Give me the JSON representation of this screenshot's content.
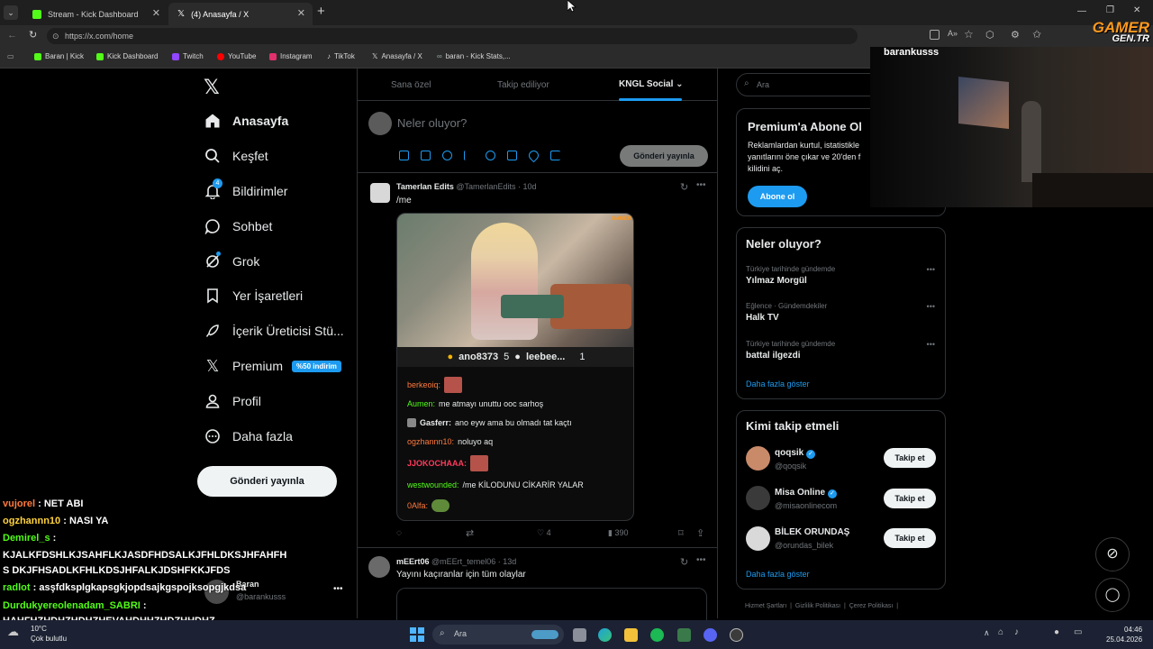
{
  "browser": {
    "tabs": [
      {
        "label": "Stream - Kick Dashboard"
      },
      {
        "label": "(4) Anasayfa / X"
      }
    ],
    "url": "https://x.com/home",
    "bookmarks": [
      "Baran | Kick",
      "Kick Dashboard",
      "Twitch",
      "YouTube",
      "Instagram",
      "TikTok",
      "Anasayfa / X",
      "baran - Kick Stats,..."
    ]
  },
  "nav": {
    "items": [
      {
        "label": "Anasayfa",
        "icon": "home-icon"
      },
      {
        "label": "Keşfet",
        "icon": "search-icon"
      },
      {
        "label": "Bildirimler",
        "icon": "bell-icon",
        "badge": "4"
      },
      {
        "label": "Sohbet",
        "icon": "chat-icon"
      },
      {
        "label": "Grok",
        "icon": "grok-icon"
      },
      {
        "label": "Yer İşaretleri",
        "icon": "bookmark-icon"
      },
      {
        "label": "İçerik Üreticisi Stü...",
        "icon": "rocket-icon"
      },
      {
        "label": "Premium",
        "icon": "x-premium-icon",
        "pill": "%50 indirim"
      },
      {
        "label": "Profil",
        "icon": "profile-icon"
      },
      {
        "label": "Daha fazla",
        "icon": "more-icon"
      }
    ],
    "post_button": "Gönderi yayınla",
    "account": {
      "name": "Baran",
      "handle": "@barankusss"
    }
  },
  "feed": {
    "tabs": [
      "Sana özel",
      "Takip ediliyor",
      "KNGL Social"
    ],
    "composer_placeholder": "Neler oluyor?",
    "composer_button": "Gönderi yayınla",
    "post1": {
      "name": "Tamerlan Edits",
      "handle": "@TamerlanEdits · 10d",
      "text": "/me",
      "media_bar": {
        "left": "ano8373",
        "mid": "5",
        "right": "leebee...",
        "count": "1"
      },
      "chat": [
        {
          "user": "berkeoiq:",
          "color": "#ff7a3d",
          "msg": ""
        },
        {
          "user": "Aumen:",
          "color": "#53fc18",
          "msg": "me atmayı unuttu ooc sarhoş"
        },
        {
          "user": "Gasferr:",
          "color": "#e7e9ea",
          "msg": "ano eyw ama bu olmadı tat kaçtı"
        },
        {
          "user": "ogzhannn10:",
          "color": "#ff7a3d",
          "msg": "noluyo aq"
        },
        {
          "user": "JJOKOCHAAA:",
          "color": "#ff3b5c",
          "msg": ""
        },
        {
          "user": "westwounded:",
          "color": "#53fc18",
          "msg": "/me KİLODUNU CİKARİR YALAR"
        },
        {
          "user": "0Alfa:",
          "color": "#ff7a3d",
          "msg": ""
        }
      ],
      "stats": {
        "likes": "4",
        "views": "390"
      }
    },
    "post2": {
      "name": "mEErt06",
      "handle": "@mEErt_temel06 · 13d",
      "text": "Yayını kaçıranlar için tüm olaylar"
    }
  },
  "sidebar": {
    "search_placeholder": "Ara",
    "premium": {
      "title": "Premium'a Abone Ol",
      "text": "Reklamlardan kurtul, istatistikle yanıtlarını öne çıkar ve 20'den f kilidini aç.",
      "button": "Abone ol"
    },
    "trends_title": "Neler oluyor?",
    "trends": [
      {
        "meta": "Türkiye tarihinde gündemde",
        "name": "Yılmaz Morgül"
      },
      {
        "meta": "Eğlence · Gündemdekiler",
        "name": "Halk TV"
      },
      {
        "meta": "Türkiye tarihinde gündemde",
        "name": "battal ilgezdi"
      }
    ],
    "show_more": "Daha fazla göster",
    "follow_title": "Kimi takip etmeli",
    "follow": [
      {
        "name": "qoqsik",
        "handle": "@qoqsik",
        "verified": true,
        "color": "#c98a6a"
      },
      {
        "name": "Misa Online",
        "handle": "@misaonlinecom",
        "verified": true,
        "color": "#3a3a3a"
      },
      {
        "name": "BİLEK ORUNDAŞ",
        "handle": "@orundas_bilek",
        "verified": false,
        "color": "#d9d9d9"
      }
    ],
    "follow_button": "Takip et",
    "footer": [
      "Hizmet Şartları",
      "Gizlilik Politikası",
      "Çerez Politikası"
    ]
  },
  "stream": {
    "webcam_name": "barankusss",
    "logo_top": "GAMER",
    "logo_bottom": "GEN.TR",
    "chat": [
      {
        "user": "vujorel",
        "color": "#ff7a3d",
        "msg": "NET ABI"
      },
      {
        "user": "ogzhannn10",
        "color": "#ffd23d",
        "msg": "NASI YA"
      },
      {
        "user": "Demirel_s",
        "color": "#53fc18",
        "msg": "KJALKFDSHLKJSAHFLKJASDFHDSALKJFHLDKSJHFAHFHS DKJFHSADLKFHLKDSJHFALKJDSHFKKJFDS"
      },
      {
        "user": "radlot",
        "color": "#53fc18",
        "msg": "asşfdksplgkapsgkjopdsajkgspojksopgjkdsa"
      },
      {
        "user": "Durdukyereolenadam_SABRI",
        "color": "#53fc18",
        "msg": "HAHFHZHDHZHDHZHEVAHDHHZHDZHHDHZ"
      }
    ]
  },
  "taskbar": {
    "weather_temp": "10°C",
    "weather_text": "Çok bulutlu",
    "search": "Ara",
    "time": "04:46",
    "date": "25.04.2026"
  }
}
